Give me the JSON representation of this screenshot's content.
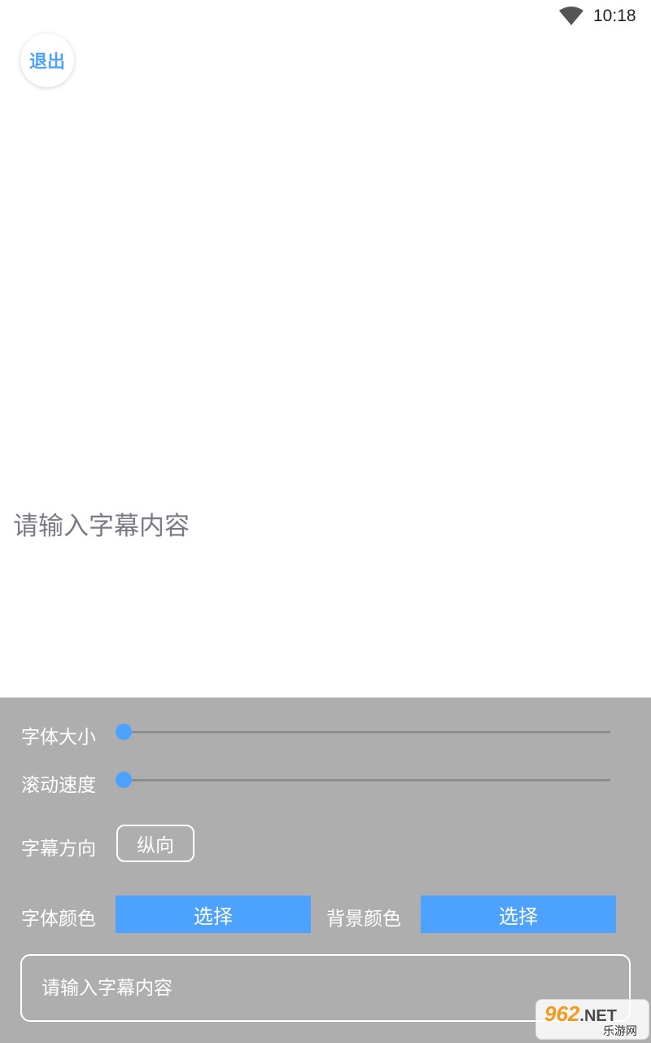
{
  "status_bar": {
    "time": "10:18",
    "icons": [
      "wifi-icon"
    ]
  },
  "header": {
    "exit_label": "退出"
  },
  "preview": {
    "text": "请输入字幕内容"
  },
  "settings": {
    "font_size": {
      "label": "字体大小",
      "value": 0
    },
    "scroll_speed": {
      "label": "滚动速度",
      "value": 0
    },
    "direction": {
      "label": "字幕方向",
      "value": "纵向"
    },
    "font_color": {
      "label": "字体颜色",
      "button": "选择"
    },
    "bg_color": {
      "label": "背景颜色",
      "button": "选择"
    },
    "input": {
      "placeholder": "请输入字幕内容",
      "value": ""
    }
  },
  "watermark": {
    "brand": "962",
    "domain": ".NET",
    "sub": "乐游网"
  },
  "colors": {
    "accent": "#4da2ff",
    "panel": "#aeaeae",
    "preview_text": "#7a7a86"
  }
}
